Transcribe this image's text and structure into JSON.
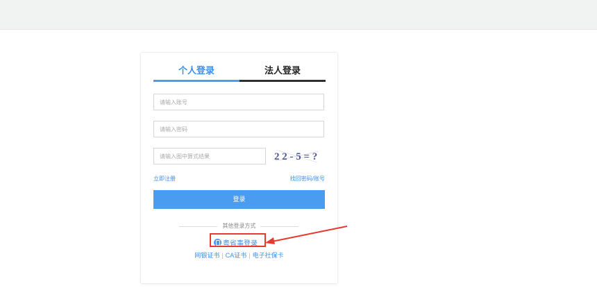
{
  "tabs": {
    "personal": "个人登录",
    "legal": "法人登录"
  },
  "form": {
    "account_placeholder": "请输入账号",
    "password_placeholder": "请输入密码",
    "captcha_placeholder": "请输入图中算式结果",
    "captcha_text": "2 2 - 5 = ?"
  },
  "links": {
    "register": "立即注册",
    "recover": "找回密码/账号"
  },
  "login_button": "登录",
  "other_methods_label": "其他登录方式",
  "yss_login": "粤省事登录",
  "alt_methods": [
    "网银证书",
    "CA证书",
    "电子社保卡"
  ],
  "colors": {
    "accent": "#4a9cf0",
    "highlight": "#e53a2e"
  }
}
